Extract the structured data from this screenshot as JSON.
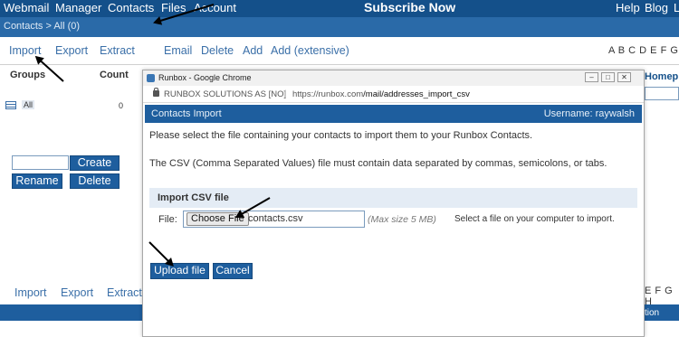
{
  "topnav": {
    "items": [
      "Webmail",
      "Manager",
      "Contacts",
      "Files",
      "Account"
    ],
    "subscribe": "Subscribe Now",
    "help": "Help",
    "blog": "Blog",
    "extra": "L"
  },
  "breadcrumb": "Contacts > All (0)",
  "toolbar": {
    "import": "Import",
    "export": "Export",
    "extract": "Extract",
    "email": "Email",
    "delete": "Delete",
    "add": "Add",
    "add_extensive": "Add (extensive)",
    "alphabet": "A B C D E F G H"
  },
  "groups_panel": {
    "groups_header": "Groups",
    "count_header": "Count",
    "group_name": "All",
    "group_count": "0",
    "create_label": "Create",
    "rename_label": "Rename",
    "delete_label": "Delete"
  },
  "right_column": {
    "homepage_header": "Homep"
  },
  "bottom_toolbar": {
    "import": "Import",
    "export": "Export",
    "extract": "Extract",
    "alphabet": "E F G H",
    "bar_text": "tion"
  },
  "popup": {
    "window_title": "Runbox - Google Chrome",
    "addr_org": "RUNBOX SOLUTIONS AS [NO]",
    "addr_url_host": "https://runbox.com",
    "addr_url_path": "/mail/addresses_import_csv",
    "header_title": "Contacts Import",
    "header_user": "Username: raywalsh",
    "msg1": "Please select the file containing your contacts to import them to your Runbox Contacts.",
    "msg2": "The CSV (Comma Separated Values) file must contain data separated by commas, semicolons, or tabs.",
    "section_title": "Import CSV file",
    "file_label": "File:",
    "choose_file": "Choose File",
    "file_name": "contacts.csv",
    "max_size": "(Max size 5 MB)",
    "hint": "Select a file on your computer to import.",
    "upload_label": "Upload file",
    "cancel_label": "Cancel"
  },
  "colors": {
    "topbar": "#14508a",
    "accent": "#1e5e9e",
    "link": "#3a6fa8"
  }
}
